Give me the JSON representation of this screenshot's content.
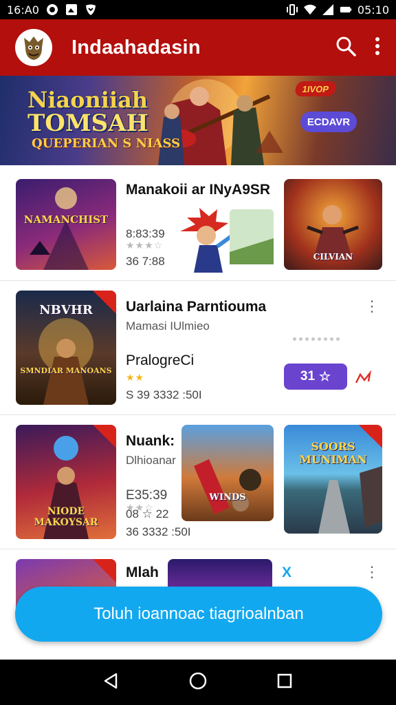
{
  "status_bar": {
    "time": "16:A0",
    "right_time": "05:10",
    "icons_left": [
      "alarm-icon",
      "gallery-icon",
      "shield-icon"
    ],
    "icons_right": [
      "vibrate-icon",
      "wifi-icon",
      "signal-icon",
      "battery-icon"
    ]
  },
  "app_bar": {
    "title": "Indaahadasin",
    "avatar_icon": "mascot-avatar-icon",
    "actions": [
      "search-icon",
      "more-vert-icon"
    ]
  },
  "banner": {
    "title_line1": "Niaoniiah",
    "title_line2": "TOMSAH",
    "subtitle": "QUEPERIAN S NIASS",
    "badge_text": "1IVOP",
    "pill_text": "ECDAVR"
  },
  "rows": [
    {
      "title": "Manakoii ar INyA9SR",
      "thumb1_label": "NAMANCHIST",
      "time": "8:83:39",
      "stars": "★★★☆",
      "meta": "36 7:88",
      "thumb3_label": "CILVIAN"
    },
    {
      "title": "Uarlaina Parntiouma",
      "subtitle": "Mamasi IUlmieo",
      "thumb1_label": "NBVHR",
      "thumb1_sub": "SMNDIAR MANOANS",
      "name": "PralogreCi",
      "stars": "★★",
      "meta": "S 39 3332 :50I",
      "rating": "31",
      "more": "⋮"
    },
    {
      "title": "Nuank:",
      "subtitle": "Dlhioanar",
      "time": "E35:39",
      "stars": "★★☆",
      "time2": "08 ☆ 22",
      "meta": "36 3332 :50I",
      "thumb1_label": "NIODE MAKOYSAR",
      "thumb2_label": "WINDS",
      "thumb3_label": "SOORS MUNIMAN"
    },
    {
      "title": "Mlah",
      "accent": "X",
      "more": "⋮"
    }
  ],
  "cta": {
    "label": "Toluh ioannoac tiagrioalnban"
  },
  "nav": {
    "icons": [
      "back-icon",
      "home-icon",
      "recents-icon"
    ]
  },
  "colors": {
    "app_bar": "#b30f0c",
    "cta": "#12a8f0",
    "rating_pill": "#6a43cf"
  }
}
